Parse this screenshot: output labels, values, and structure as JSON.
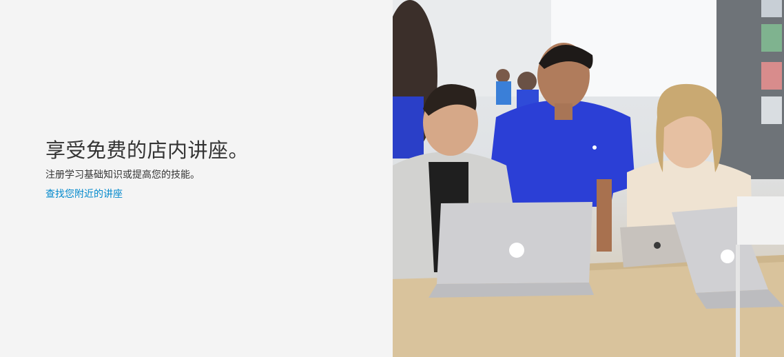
{
  "promo": {
    "headline": "享受免费的店内讲座。",
    "subhead": "注册学习基础知识或提高您的技能。",
    "link": "查找您附近的讲座"
  },
  "photo": {
    "alt": "Apple Store staff member helping two customers using MacBook laptops at a wooden table",
    "colors": {
      "shirt_blue": "#2b3fd6",
      "table_wood": "#d7c29b",
      "laptop_silver": "#cfcfd2"
    }
  }
}
